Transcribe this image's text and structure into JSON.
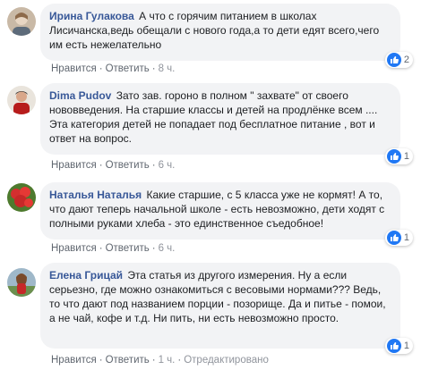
{
  "comments": [
    {
      "author": "Ирина Гулакова",
      "text": "А что с горячим питанием в школах Лисичанска,ведь обещали с нового года,а то дети едят всего,чего им есть нежелательно",
      "likes": "2",
      "like_label": "Нравится",
      "reply_label": "Ответить",
      "time": "8 ч.",
      "edited": ""
    },
    {
      "author": "Dima Pudov",
      "text": "Зато зав. гороно в полном \" захвате\" от своего нововведения. На старшие классы и детей на продлёнке всем .... Эта категория детей не попадает под бесплатное питание , вот и ответ на вопрос.",
      "likes": "1",
      "like_label": "Нравится",
      "reply_label": "Ответить",
      "time": "6 ч.",
      "edited": ""
    },
    {
      "author": "Наталья Наталья",
      "text": "Какие старшие, с 5 класса уже не кормят! А то, что дают теперь начальной школе - есть невозможно, дети ходят с полными руками хлеба - это единственное съедобное!",
      "likes": "1",
      "like_label": "Нравится",
      "reply_label": "Ответить",
      "time": "6 ч.",
      "edited": ""
    },
    {
      "author": "Елена Грицай",
      "text": "Эта статья из другого измерения. Ну а если серьезно, где можно ознакомиться с весовыми нормами??? Ведь, то что дают под названием порции - позорище. Да и питье - помои, а не чай, кофе и т.д. Ни пить, ни есть невозможно просто.",
      "likes": "1",
      "like_label": "Нравится",
      "reply_label": "Ответить",
      "time": "1 ч.",
      "edited": "Отредактировано"
    }
  ],
  "colors": {
    "author": "#385898",
    "bubble": "#f2f3f5",
    "meta": "#606770",
    "like_badge": "#2078f4"
  },
  "icons": {
    "like": "thumbs-up-icon"
  }
}
